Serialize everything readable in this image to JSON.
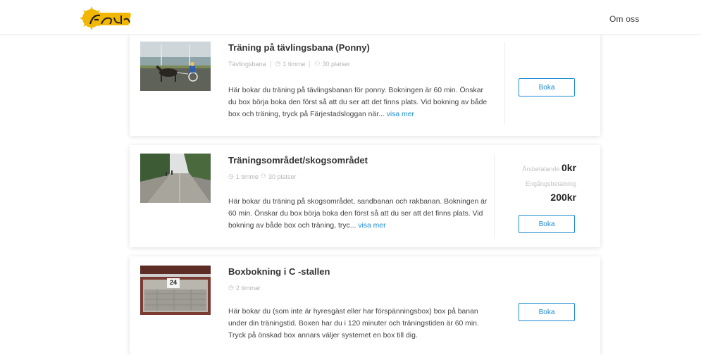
{
  "header": {
    "logo_text": "Färjestad",
    "nav_link": "Om oss"
  },
  "colors": {
    "accent": "#1c8ad1",
    "logo_yellow": "#f2b705"
  },
  "cards": [
    {
      "title": "Träning på tävlingsbana (Ponny)",
      "category": "Tävlingsbana",
      "duration": "1 timme",
      "capacity": "30 platser",
      "description": "Här bokar du träning på tävlingsbanan för ponny. Bokningen är 60 min. Önskar du box börja boka den först så att du ser att det finns plats. Vid bokning av både box och träning, tryck på Färjestadsloggan när...",
      "more_label": "visa mer",
      "book_label": "Boka"
    },
    {
      "title": "Träningsområdet/skogsområdet",
      "duration": "1 timme",
      "capacity": "30 platser",
      "description": "Här bokar du träning på skogsområdet, sandbanan och rakbanan. Bokningen är 60 min. Önskar du box börja boka den först så att du ser att det finns plats. Vid bokning av både box och träning, tryc...",
      "more_label": "visa mer",
      "annual_label": "Årsbetalande",
      "annual_price": "0kr",
      "single_label": "Engångsbetalning",
      "single_price": "200kr",
      "book_label": "Boka"
    },
    {
      "title": "Boxbokning i C -stallen",
      "duration": "2 timmar",
      "description": "Här bokar du (som inte är hyresgäst eller har förspänningsbox) box på banan under din träningstid. Boxen har du i 120 minuter och träningstiden är 60 min. Tryck på önskad box annars väljer systemet en box till dig.",
      "box_number": "24",
      "book_label": "Boka"
    }
  ]
}
